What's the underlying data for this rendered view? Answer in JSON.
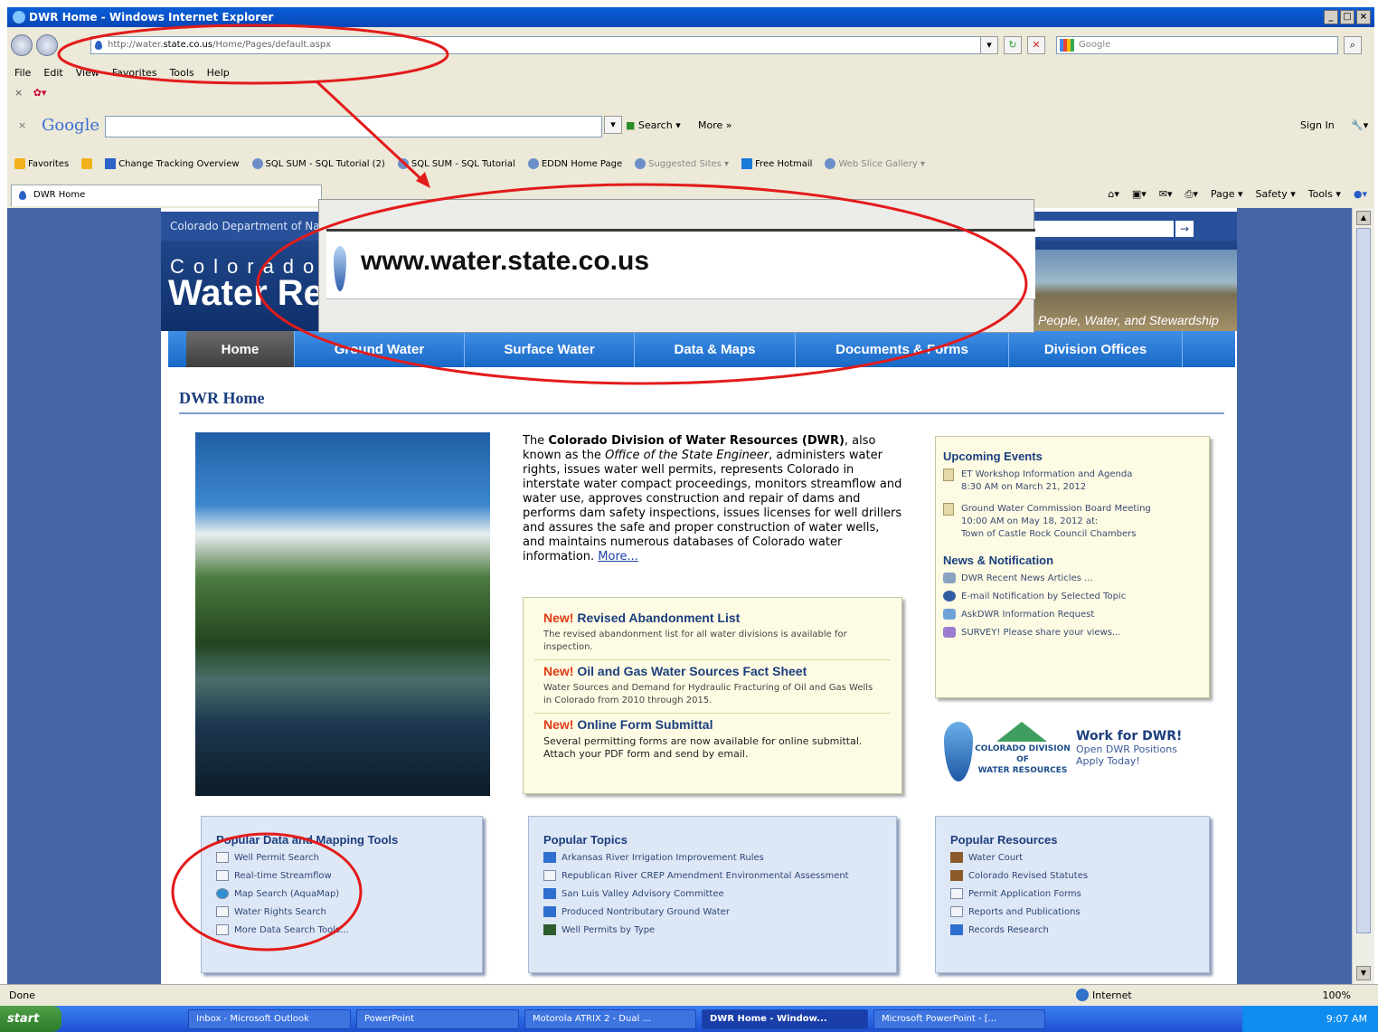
{
  "window": {
    "title": "DWR Home - Windows Internet Explorer",
    "min": "_",
    "max": "□",
    "close": "×"
  },
  "address_bar": {
    "url_prefix": "http://water.",
    "url_domain": "state.co.us",
    "url_path": "/Home/Pages/default.aspx",
    "google_placeholder": "Google"
  },
  "menu": [
    "File",
    "Edit",
    "View",
    "Favorites",
    "Tools",
    "Help"
  ],
  "google_toolbar": {
    "logo": "Google",
    "search_label": "Search",
    "more_label": "More »",
    "signin_label": "Sign In"
  },
  "favorites_bar": {
    "favorites_label": "Favorites",
    "items": [
      "Change Tracking Overview",
      "SQL SUM - SQL Tutorial (2)",
      "SQL SUM - SQL Tutorial",
      "EDDN Home Page",
      "Suggested Sites ▾",
      "Free Hotmail",
      "Web Slice Gallery ▾"
    ]
  },
  "tab": {
    "label": "DWR Home"
  },
  "command_bar": [
    "Page ▾",
    "Safety ▾",
    "Tools ▾"
  ],
  "zoom_callout": {
    "url": "www.water.state.co.us"
  },
  "site": {
    "dept_text": "Colorado Department of Natural Resources",
    "logo_line1": "Colorado",
    "logo_line2": "Water Resources",
    "search_go": "→",
    "tagline": "People, Water, and Stewardship",
    "nav": [
      "Home",
      "Ground Water",
      "Surface Water",
      "Data & Maps",
      "Documents & Forms",
      "Division Offices"
    ],
    "page_title": "DWR Home",
    "intro": {
      "lead": "The ",
      "org": "Colorado Division of Water Resources (DWR)",
      "part2": ", also known as the ",
      "aka": "Office of the State Engineer",
      "body": ", administers water rights, issues water well permits, represents Colorado in interstate water compact proceedings, monitors streamflow and water use, approves construction and repair of dams and performs dam safety inspections, issues licenses for well drillers and assures the safe and proper construction of water wells, and maintains numerous databases of Colorado water information. ",
      "more": "More..."
    },
    "news": [
      {
        "new": "New!",
        "title": "Revised Abandonment List",
        "desc": "The revised abandonment list for all water divisions is available for inspection."
      },
      {
        "new": "New!",
        "title": "Oil and Gas Water Sources Fact Sheet",
        "desc": "Water Sources and Demand for Hydraulic Fracturing of Oil and Gas Wells in Colorado from 2010 through 2015."
      },
      {
        "new": "New!",
        "title": "Online Form Submittal",
        "desc": "Several permitting forms are now available for online submittal. Attach your PDF form and send by email."
      }
    ],
    "events": {
      "title": "Upcoming Events",
      "items": [
        {
          "line1": "ET Workshop Information and Agenda",
          "line2": "8:30 AM on March 21, 2012",
          "line3": ""
        },
        {
          "line1": "Ground Water Commission Board Meeting",
          "line2": "10:00 AM on May 18, 2012 at:",
          "line3": "Town of Castle Rock Council Chambers"
        }
      ]
    },
    "news_notification": {
      "title": "News & Notification",
      "items": [
        "DWR Recent News Articles ...",
        "E-mail Notification by Selected Topic",
        "AskDWR Information Request",
        "SURVEY! Please share your views..."
      ]
    },
    "work": {
      "logo_line1": "COLORADO DIVISION OF",
      "logo_line2": "WATER RESOURCES",
      "title": "Work for DWR!",
      "line1": "Open DWR Positions",
      "line2": "Apply Today!"
    },
    "tools": {
      "title": "Popular Data and Mapping Tools",
      "items": [
        "Well Permit Search",
        "Real-time Streamflow",
        "Map Search (AquaMap)",
        "Water Rights Search",
        "More Data Search Tools..."
      ]
    },
    "topics": {
      "title": "Popular Topics",
      "items": [
        "Arkansas River Irrigation Improvement Rules",
        "Republican River CREP Amendment Environmental Assessment",
        "San Luis Valley Advisory Committee",
        "Produced Nontributary Ground Water",
        "Well Permits by Type"
      ]
    },
    "resources": {
      "title": "Popular Resources",
      "items": [
        "Water Court",
        "Colorado Revised Statutes",
        "Permit Application Forms",
        "Reports and Publications",
        "Records Research"
      ]
    }
  },
  "status": {
    "text": "Done",
    "zone": "Internet",
    "zoom": "100%"
  },
  "taskbar": {
    "start": "start",
    "buttons": [
      "Inbox - Microsoft Outlook",
      "PowerPoint",
      "Motorola ATRIX 2 - Dual ...",
      "DWR Home - Window...",
      "Microsoft PowerPoint - [..."
    ],
    "clock": "9:07 AM"
  },
  "colors": {
    "annotation": "#e31b1b",
    "nav_blue": "#1868c6",
    "title_blue": "#1b3e7e",
    "new_red": "#e03a14"
  }
}
